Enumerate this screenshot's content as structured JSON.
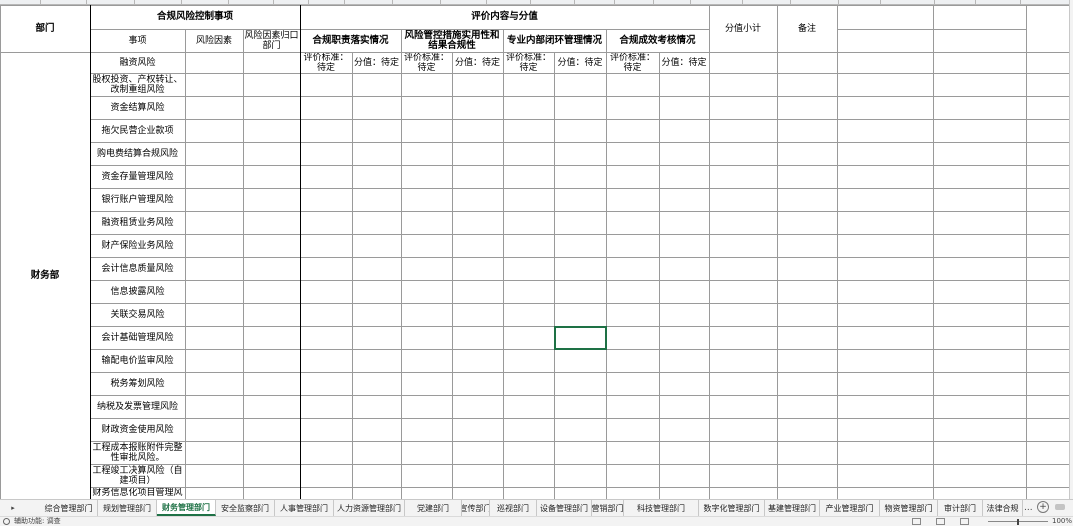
{
  "sheet": {
    "headers": {
      "department": "部门",
      "control_group": "合规风险控制事项",
      "item": "事项",
      "risk_factor": "风险因素",
      "risk_dept": "风险因素归口部门",
      "eval_group": "评价内容与分值",
      "g1": "合规职责落实情况",
      "g2": "风险管控措施实用性和结果合规性",
      "g3": "专业内部闭环管理情况",
      "g4": "合规成效考核情况",
      "criteria": "评价标准：待定",
      "score": "分值：待定",
      "subtotal": "分值小计",
      "remark": "备注"
    },
    "department_value": "财务部",
    "rows": [
      "融资风险",
      "股权投资、产权转让、改制重组风险",
      "资金结算风险",
      "拖欠民营企业款项",
      "购电费结算合规风险",
      "资金存量管理风险",
      "银行账户管理风险",
      "融资租赁业务风险",
      "财产保险业务风险",
      "会计信息质量风险",
      "信息披露风险",
      "关联交易风险",
      "会计基础管理风险",
      "输配电价监审风险",
      "税务筹划风险",
      "纳税及发票管理风险",
      "财政资金使用风险",
      "工程成本报账附件完整性审批风险。",
      "工程竣工决算风险（自建项目）",
      "财务信息化项目管理风"
    ]
  },
  "tabs": [
    {
      "label": "综合管理部门",
      "active": false
    },
    {
      "label": "规划管理部门",
      "active": false
    },
    {
      "label": "财务管理部门",
      "active": true
    },
    {
      "label": "安全监察部门",
      "active": false
    },
    {
      "label": "人事管理部门",
      "active": false
    },
    {
      "label": "人力资源管理部门",
      "active": false
    },
    {
      "label": "党建部门",
      "active": false
    },
    {
      "label": "宣传部门",
      "active": false
    },
    {
      "label": "巡视部门",
      "active": false
    },
    {
      "label": "设备管理部门",
      "active": false
    },
    {
      "label": "营销部门",
      "active": false
    },
    {
      "label": "科技管理部门",
      "active": false
    },
    {
      "label": "数字化管理部门",
      "active": false
    },
    {
      "label": "基建管理部门",
      "active": false
    },
    {
      "label": "产业管理部门",
      "active": false
    },
    {
      "label": "物资管理部门",
      "active": false
    },
    {
      "label": "审计部门",
      "active": false
    },
    {
      "label": "法律合规"
    }
  ],
  "tabbar": {
    "more": "...",
    "add": "+",
    "nav_prev": "▸"
  },
  "status": {
    "text": "辅助功能: 调查",
    "zoom": "100%"
  },
  "colors": {
    "grid": "#9a9a9a",
    "selection": "#1e7145",
    "active_tab": "#1e7145"
  }
}
